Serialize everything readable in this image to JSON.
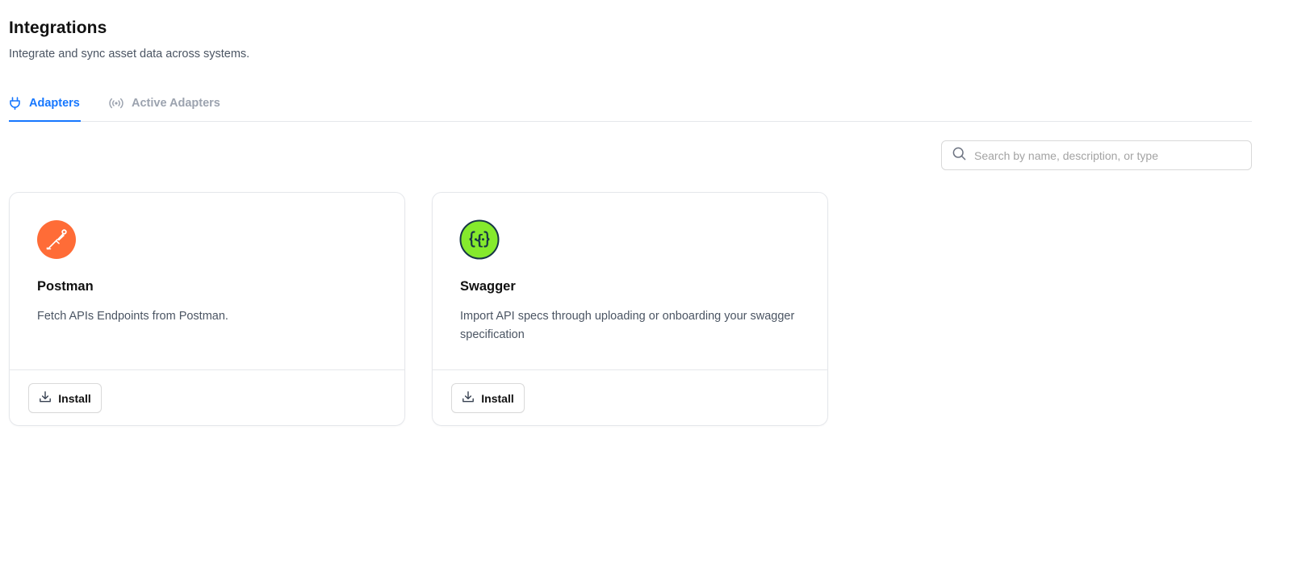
{
  "header": {
    "title": "Integrations",
    "subtitle": "Integrate and sync asset data across systems."
  },
  "tabs": [
    {
      "label": "Adapters",
      "icon": "plug-icon",
      "active": true
    },
    {
      "label": "Active Adapters",
      "icon": "broadcast-icon",
      "active": false
    }
  ],
  "search": {
    "placeholder": "Search by name, description, or type",
    "value": "",
    "icon": "search-icon"
  },
  "adapters": [
    {
      "name": "Postman",
      "description": "Fetch APIs Endpoints from Postman.",
      "logo": "postman-logo-icon",
      "logo_color": "#ff6c37",
      "action_label": "Install",
      "action_icon": "download-icon"
    },
    {
      "name": "Swagger",
      "description": "Import API specs through uploading or onboarding your swagger specification",
      "logo": "swagger-logo-icon",
      "logo_color": "#85ea2d",
      "action_label": "Install",
      "action_icon": "download-icon"
    }
  ],
  "colors": {
    "accent": "#1677ff",
    "muted_text": "#9ca3af",
    "border": "#e5e7eb"
  }
}
